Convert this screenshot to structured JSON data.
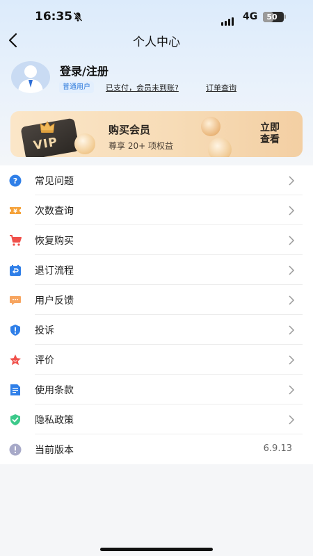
{
  "status_bar": {
    "time": "16:35",
    "network": "4G",
    "battery": "50",
    "battery_level": 0.5
  },
  "header": {
    "title": "个人中心",
    "back_icon": "chevron-left-icon"
  },
  "profile": {
    "login_label": "登录/注册",
    "badge": "普通用户",
    "paid_link": "已支付，会员未到账?",
    "order_link": "订单查询"
  },
  "vip_banner": {
    "card_text": "VIP",
    "title": "购买会员",
    "subtitle": "尊享 20+ 项权益",
    "action_line1": "立即",
    "action_line2": "查看"
  },
  "menu": {
    "items": [
      {
        "label": "常见问题",
        "icon": "question-icon",
        "color": "#2f7fe8"
      },
      {
        "label": "次数查询",
        "icon": "ticket-icon",
        "color": "#f5a23a"
      },
      {
        "label": "恢复购买",
        "icon": "cart-icon",
        "color": "#f0504a"
      },
      {
        "label": "退订流程",
        "icon": "calendar-return-icon",
        "color": "#2f7fe8"
      },
      {
        "label": "用户反馈",
        "icon": "chat-icon",
        "color": "#f7a560"
      },
      {
        "label": "投诉",
        "icon": "shield-alert-icon",
        "color": "#2f7fe8"
      },
      {
        "label": "评价",
        "icon": "star-icon",
        "color": "#f0504a"
      },
      {
        "label": "使用条款",
        "icon": "document-icon",
        "color": "#2f7fe8"
      },
      {
        "label": "隐私政策",
        "icon": "shield-check-icon",
        "color": "#3cc98a"
      },
      {
        "label": "当前版本",
        "icon": "info-icon",
        "color": "#a7a9c8",
        "value": "6.9.13"
      }
    ]
  }
}
